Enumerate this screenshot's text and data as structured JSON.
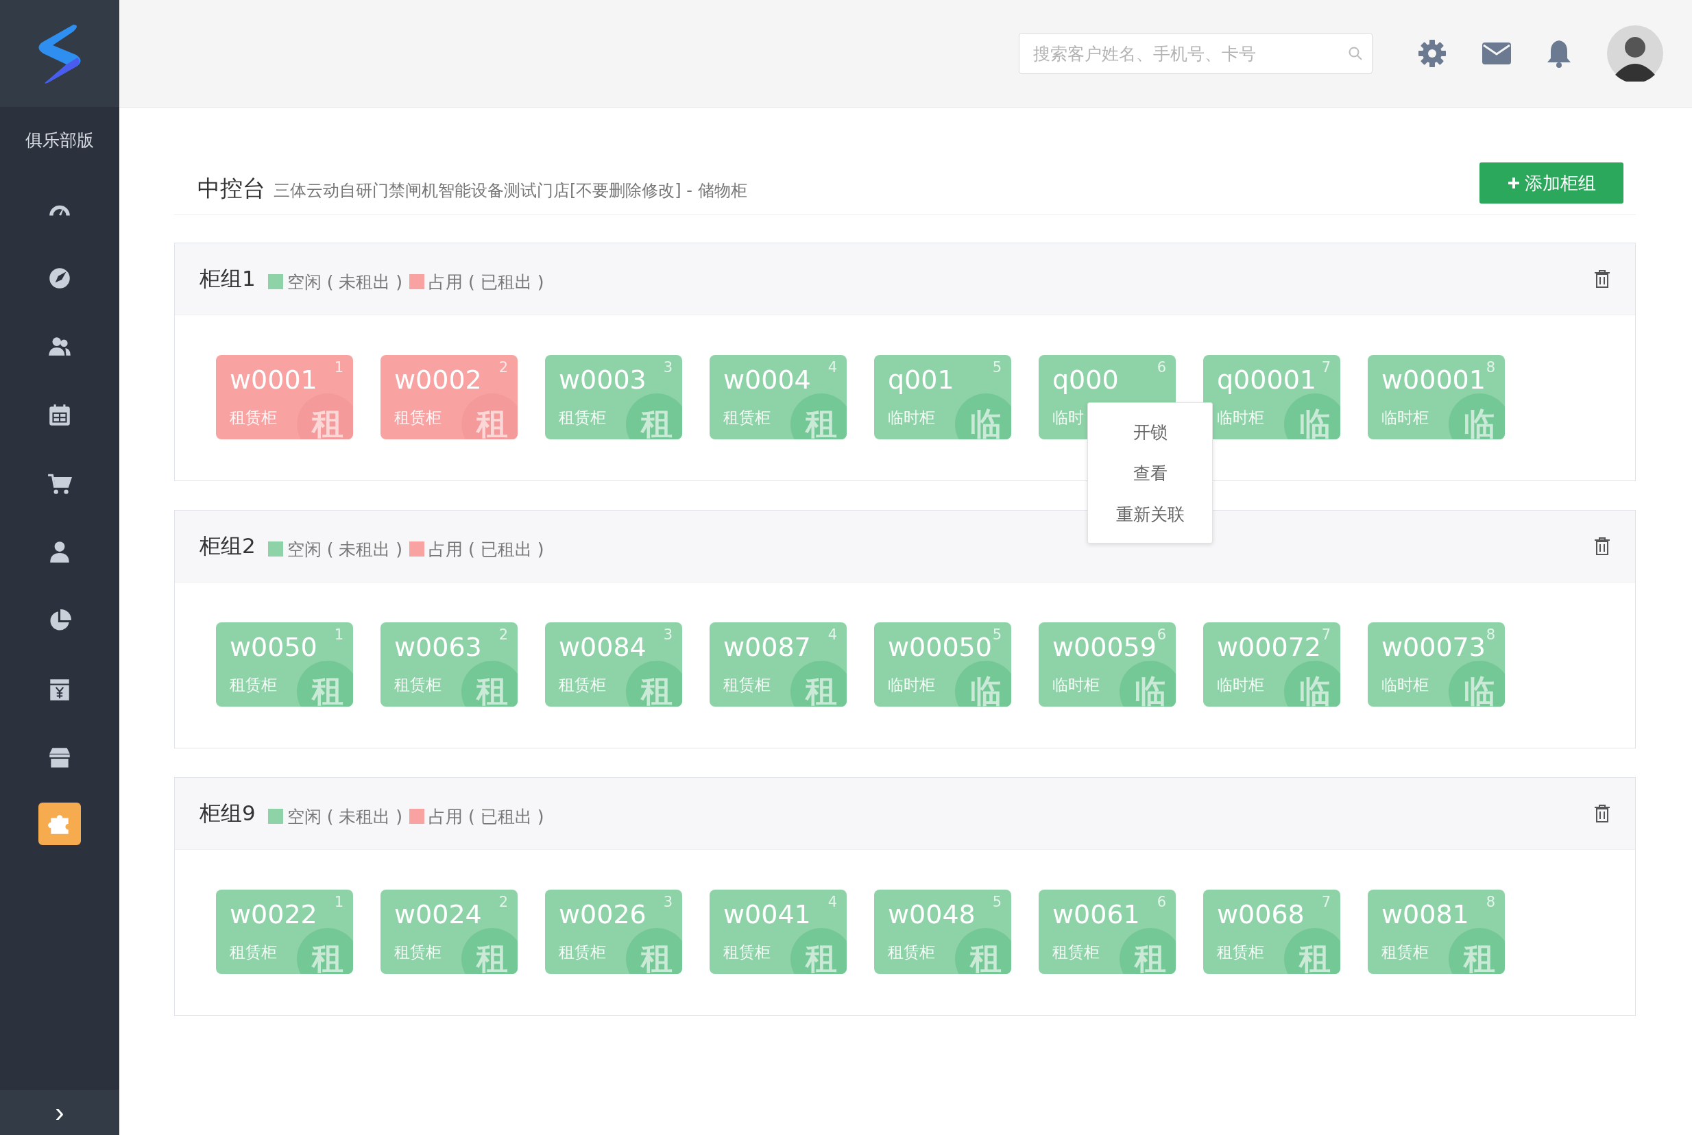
{
  "sidebar": {
    "edition": "俱乐部版",
    "items": [
      {
        "kind": "gauge",
        "selected": false
      },
      {
        "kind": "compass",
        "selected": false
      },
      {
        "kind": "users",
        "selected": false
      },
      {
        "kind": "calendar",
        "selected": false
      },
      {
        "kind": "cart",
        "selected": false
      },
      {
        "kind": "person",
        "selected": false
      },
      {
        "kind": "pie",
        "selected": false
      },
      {
        "kind": "yen",
        "selected": false
      },
      {
        "kind": "store",
        "selected": false
      },
      {
        "kind": "puzzle",
        "selected": true
      }
    ],
    "collapse": "›"
  },
  "header": {
    "search": {
      "placeholder": "搜索客户姓名、手机号、卡号"
    }
  },
  "page": {
    "title": "中控台",
    "subtitle": "三体云动自研门禁闸机智能设备测试门店[不要删除修改] - 储物柜",
    "add_button": "添加柜组"
  },
  "groups": [
    {
      "name": "柜组1",
      "legend": [
        {
          "label": "空闲 ( 未租出 )",
          "color": "#8ed3a8"
        },
        {
          "label": "占用 ( 已租出 )",
          "color": "#f9a2a2"
        }
      ],
      "lockers": [
        {
          "code": "w0001",
          "type": "租赁柜",
          "badge": "租",
          "number": "1",
          "occupied": true
        },
        {
          "code": "w0002",
          "type": "租赁柜",
          "badge": "租",
          "number": "2",
          "occupied": true
        },
        {
          "code": "w0003",
          "type": "租赁柜",
          "badge": "租",
          "number": "3",
          "occupied": false
        },
        {
          "code": "w0004",
          "type": "租赁柜",
          "badge": "租",
          "number": "4",
          "occupied": false
        },
        {
          "code": "q001",
          "type": "临时柜",
          "badge": "临",
          "number": "5",
          "occupied": false
        },
        {
          "code": "q000",
          "type": "临时",
          "number": "6",
          "occupied": false,
          "menu": [
            "开锁",
            "查看",
            "重新关联"
          ]
        },
        {
          "code": "q00001",
          "type": "临时柜",
          "badge": "临",
          "number": "7",
          "occupied": false
        },
        {
          "code": "w00001",
          "type": "临时柜",
          "badge": "临",
          "number": "8",
          "occupied": false
        }
      ]
    },
    {
      "name": "柜组2",
      "legend": [
        {
          "label": "空闲 ( 未租出 )",
          "color": "#8ed3a8"
        },
        {
          "label": "占用 ( 已租出 )",
          "color": "#f9a2a2"
        }
      ],
      "lockers": [
        {
          "code": "w0050",
          "type": "租赁柜",
          "badge": "租",
          "number": "1",
          "occupied": false
        },
        {
          "code": "w0063",
          "type": "租赁柜",
          "badge": "租",
          "number": "2",
          "occupied": false
        },
        {
          "code": "w0084",
          "type": "租赁柜",
          "badge": "租",
          "number": "3",
          "occupied": false
        },
        {
          "code": "w0087",
          "type": "租赁柜",
          "badge": "租",
          "number": "4",
          "occupied": false
        },
        {
          "code": "w00050",
          "type": "临时柜",
          "badge": "临",
          "number": "5",
          "occupied": false
        },
        {
          "code": "w00059",
          "type": "临时柜",
          "badge": "临",
          "number": "6",
          "occupied": false
        },
        {
          "code": "w00072",
          "type": "临时柜",
          "badge": "临",
          "number": "7",
          "occupied": false
        },
        {
          "code": "w00073",
          "type": "临时柜",
          "badge": "临",
          "number": "8",
          "occupied": false
        }
      ]
    },
    {
      "name": "柜组9",
      "legend": [
        {
          "label": "空闲 ( 未租出 )",
          "color": "#8ed3a8"
        },
        {
          "label": "占用 ( 已租出 )",
          "color": "#f9a2a2"
        }
      ],
      "lockers": [
        {
          "code": "w0022",
          "type": "租赁柜",
          "badge": "租",
          "number": "1",
          "occupied": false
        },
        {
          "code": "w0024",
          "type": "租赁柜",
          "badge": "租",
          "number": "2",
          "occupied": false
        },
        {
          "code": "w0026",
          "type": "租赁柜",
          "badge": "租",
          "number": "3",
          "occupied": false
        },
        {
          "code": "w0041",
          "type": "租赁柜",
          "badge": "租",
          "number": "4",
          "occupied": false
        },
        {
          "code": "w0048",
          "type": "租赁柜",
          "badge": "租",
          "number": "5",
          "occupied": false
        },
        {
          "code": "w0061",
          "type": "租赁柜",
          "badge": "租",
          "number": "6",
          "occupied": false
        },
        {
          "code": "w0068",
          "type": "租赁柜",
          "badge": "租",
          "number": "7",
          "occupied": false
        },
        {
          "code": "w0081",
          "type": "租赁柜",
          "badge": "租",
          "number": "8",
          "occupied": false
        }
      ]
    }
  ]
}
